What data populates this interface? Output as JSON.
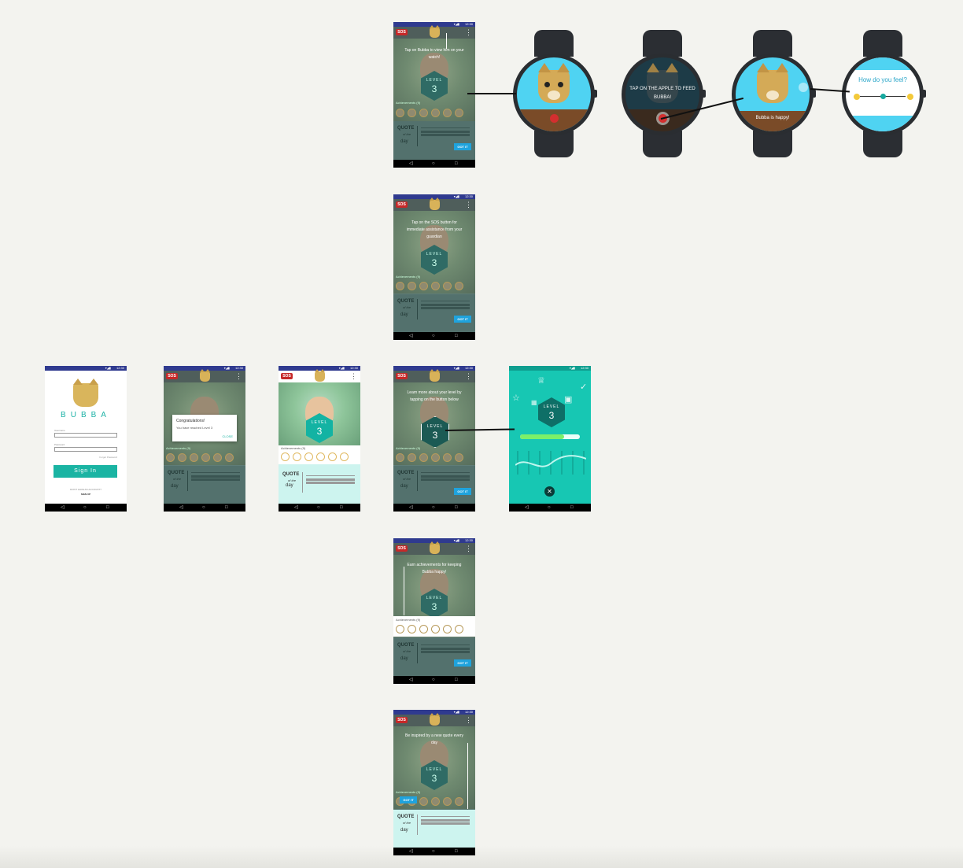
{
  "phone_ui": {
    "sos_label": "SOS",
    "level_word": "LEVEL",
    "level_number": "3",
    "achievements_label": "Achievements (9)",
    "quote_line1": "QUOTE",
    "quote_line2": "of the",
    "quote_line3": "day",
    "gotit_label": "GOT IT",
    "nav_back": "◁",
    "nav_home": "○",
    "nav_recent": "□",
    "status_time": "12:30",
    "status_icons": "▾◢▮"
  },
  "screens": {
    "watch_tip": "Tap on Bubba to view him on your watch!",
    "sos_tip": "Tap on the SOS button for immediate assistance from your guardian",
    "level_tip": "Learn more about your level by tapping on the button below",
    "achievements_tip": "Earn achievements for keeping Bubba happy!",
    "quote_tip": "Be inspired by a new quote every day"
  },
  "login": {
    "brand": "BUBBA",
    "username_label": "Username",
    "password_label": "Password",
    "forgot": "Forgot Password",
    "signin": "Sign In",
    "no_account": "DON'T HAVE AN ACCOUNT?",
    "signup": "SIGN UP"
  },
  "dialog": {
    "title": "Congratulations!",
    "message": "You have reached Level 3",
    "close": "CLOSE"
  },
  "level_screen": {
    "progress_fraction": 0.74,
    "close_icon": "✕"
  },
  "watches": {
    "feed_tip": "TAP ON THE APPLE TO FEED BUBBA!",
    "happy": "Bubba is happy!",
    "feel_question": "How do you feel?"
  },
  "colors": {
    "status_bar": "#2f3a8f",
    "sos": "#c62828",
    "teal": "#1ab4a3",
    "gotit": "#1fa3dd",
    "watch_sky": "#4fd3f2"
  }
}
